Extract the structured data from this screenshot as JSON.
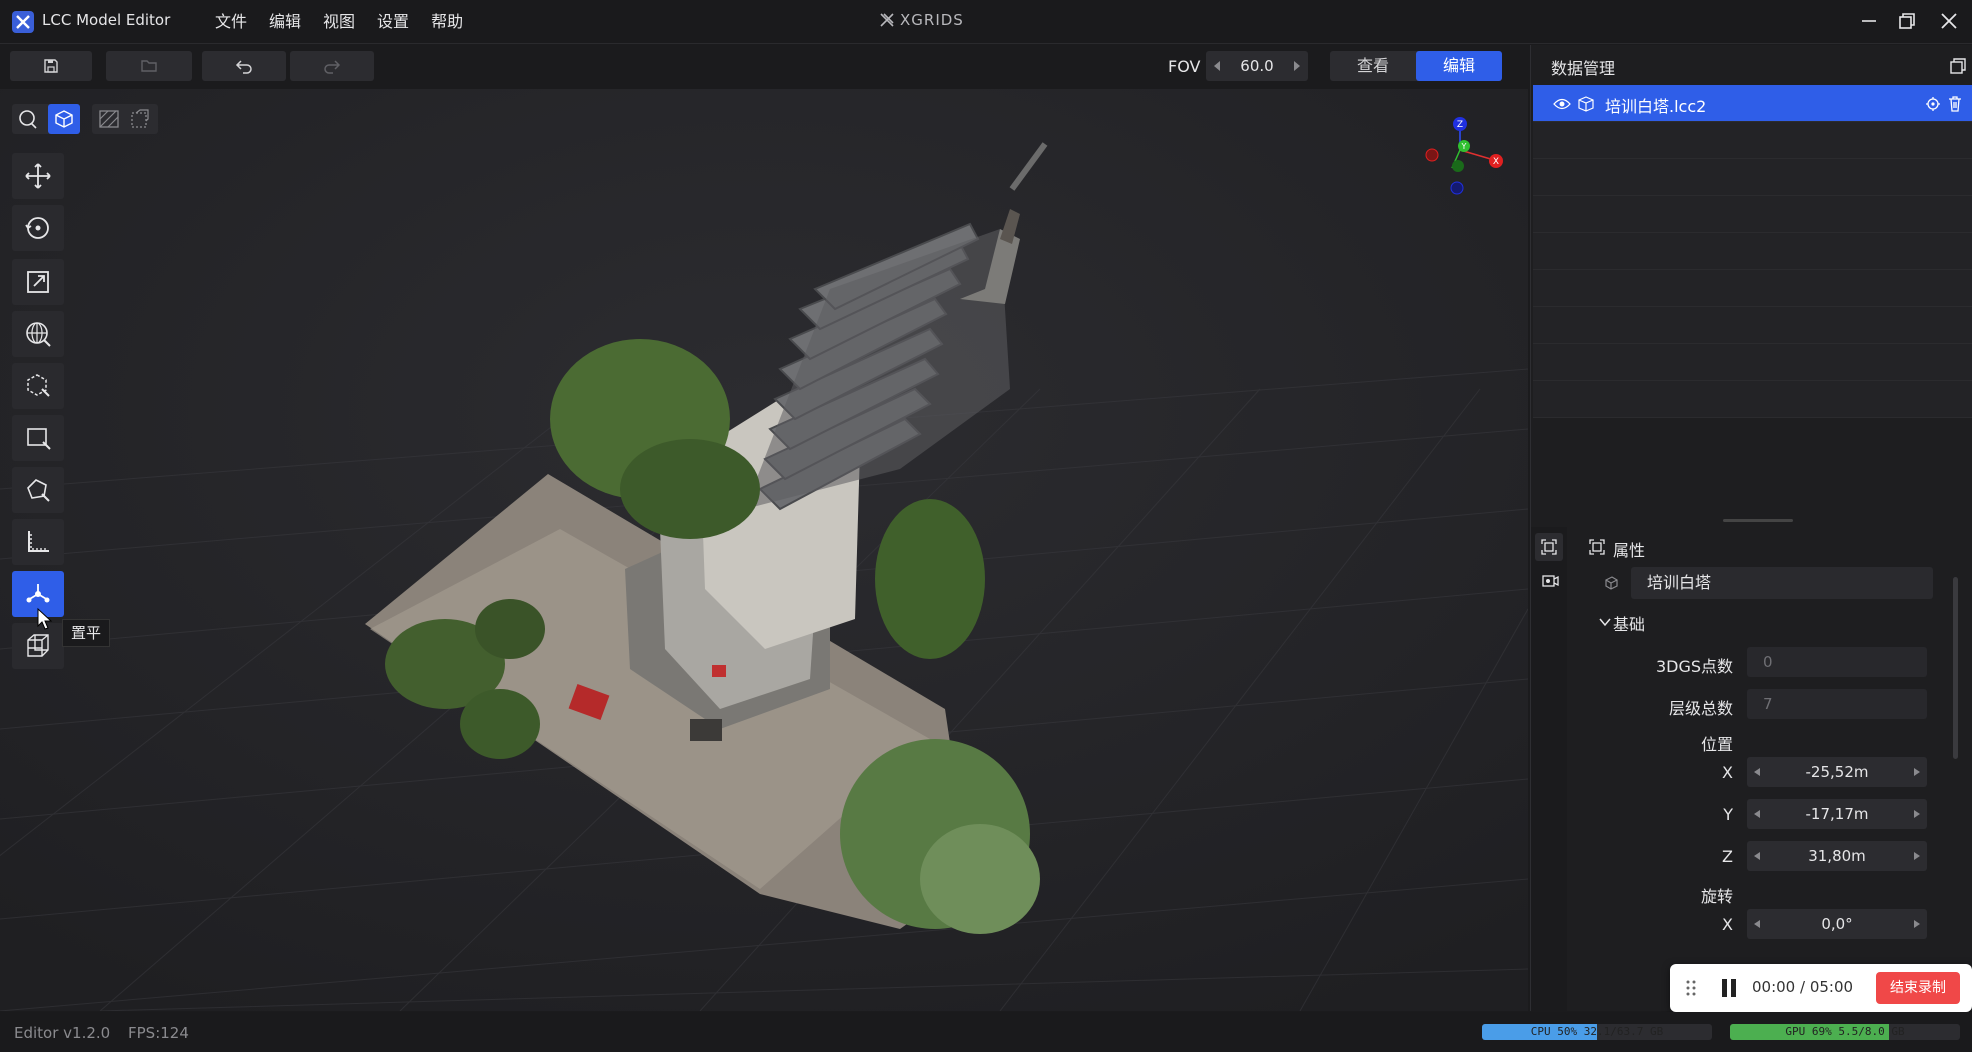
{
  "app": {
    "title": "LCC Model Editor",
    "brand": "XGRIDS"
  },
  "menu": [
    {
      "label": "文件"
    },
    {
      "label": "编辑"
    },
    {
      "label": "视图"
    },
    {
      "label": "设置"
    },
    {
      "label": "帮助"
    }
  ],
  "toolbar": {
    "fov_label": "FOV",
    "fov_value": "60.0",
    "mode_tabs": [
      {
        "label": "查看",
        "active": false
      },
      {
        "label": "编辑",
        "active": true
      }
    ]
  },
  "viewport": {
    "tooltip": "置平",
    "gizmo_axes": [
      "Z",
      "Y",
      "X"
    ],
    "active_tool": "level-tool"
  },
  "data_manager": {
    "title": "数据管理",
    "items": [
      {
        "name": "培训白塔.lcc2",
        "selected": true,
        "visible": true
      }
    ]
  },
  "properties": {
    "title": "属性",
    "object_name": "培训白塔",
    "section_label": "基础",
    "points_label": "3DGS点数",
    "points_value": "0",
    "levels_label": "层级总数",
    "levels_value": "7",
    "position_label": "位置",
    "position": [
      {
        "axis": "X",
        "value": "-25,52m"
      },
      {
        "axis": "Y",
        "value": "-17,17m"
      },
      {
        "axis": "Z",
        "value": "31,80m"
      }
    ],
    "rotation_label": "旋转",
    "rotation": [
      {
        "axis": "X",
        "value": "0,0°"
      }
    ]
  },
  "recording": {
    "time": "00:00 / 05:00",
    "stop_label": "结束录制"
  },
  "status": {
    "version": "Editor v1.2.0",
    "fps": "FPS:124",
    "cpu": {
      "text": "CPU 50% 32.1/63.7 GB",
      "percent": 50,
      "color": "#4a9de8"
    },
    "gpu": {
      "text": "GPU 69% 5.5/8.0 GB",
      "percent": 69,
      "color": "#4caf50"
    }
  },
  "colors": {
    "accent": "#2f5ee8",
    "rec_stop": "#f04848"
  }
}
